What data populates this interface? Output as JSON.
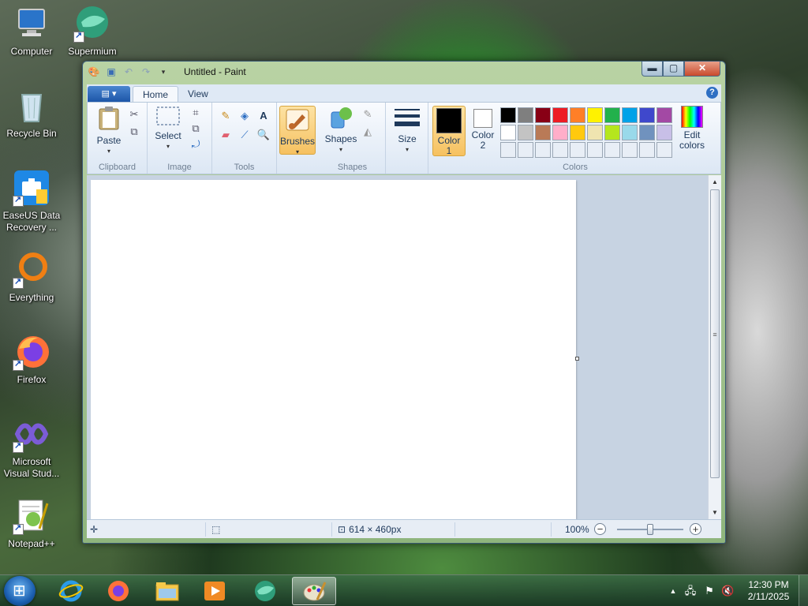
{
  "desktop": {
    "icons": [
      {
        "label": "Computer",
        "icon": "computer-icon"
      },
      {
        "label": "Supermium",
        "icon": "supermium-icon"
      },
      {
        "label": "Recycle Bin",
        "icon": "recycle-bin-icon"
      },
      {
        "label": "EaseUS Data Recovery ...",
        "icon": "easeus-icon"
      },
      {
        "label": "Everything",
        "icon": "everything-icon"
      },
      {
        "label": "Firefox",
        "icon": "firefox-icon"
      },
      {
        "label": "Microsoft Visual Stud...",
        "icon": "visual-studio-icon"
      },
      {
        "label": "Notepad++",
        "icon": "notepad-plus-plus-icon"
      }
    ]
  },
  "window": {
    "title": "Untitled - Paint",
    "controls": {
      "minimize": "▬",
      "maximize": "▢",
      "close": "✕"
    }
  },
  "ribbon": {
    "app_menu": "▤ ▾",
    "tabs": [
      {
        "label": "Home",
        "active": true
      },
      {
        "label": "View",
        "active": false
      }
    ],
    "groups": {
      "clipboard": {
        "label": "Clipboard",
        "paste": "Paste"
      },
      "image": {
        "label": "Image",
        "select": "Select"
      },
      "tools": {
        "label": "Tools"
      },
      "brushes": {
        "label": "Brushes"
      },
      "shapes": {
        "label": "Shapes",
        "shapes_btn": "Shapes"
      },
      "size": {
        "label": "Size"
      },
      "colors": {
        "label": "Colors",
        "color1": "Color 1",
        "color2": "Color 2",
        "edit": "Edit colors",
        "color1_value": "#000000",
        "color2_value": "#ffffff",
        "palette_row1": [
          "#000000",
          "#7f7f7f",
          "#880015",
          "#ed1c24",
          "#ff7f27",
          "#fff200",
          "#22b14c",
          "#00a2e8",
          "#3f48cc",
          "#a349a4"
        ],
        "palette_row2": [
          "#ffffff",
          "#c3c3c3",
          "#b97a57",
          "#ffaec9",
          "#ffc90e",
          "#efe4b0",
          "#b5e61d",
          "#99d9ea",
          "#7092be",
          "#c8bfe7"
        ],
        "palette_row3": [
          "#e8eef6",
          "#e8eef6",
          "#e8eef6",
          "#e8eef6",
          "#e8eef6",
          "#e8eef6",
          "#e8eef6",
          "#e8eef6",
          "#e8eef6",
          "#e8eef6"
        ]
      }
    }
  },
  "statusbar": {
    "canvas_size": "614 × 460px",
    "zoom": "100%",
    "zoom_level_fraction": 0.5
  },
  "taskbar": {
    "apps": [
      "internet-explorer-icon",
      "firefox-icon",
      "file-explorer-icon",
      "media-player-icon",
      "supermium-icon",
      "paint-icon"
    ],
    "clock": {
      "time": "12:30 PM",
      "date": "2/11/2025"
    }
  }
}
